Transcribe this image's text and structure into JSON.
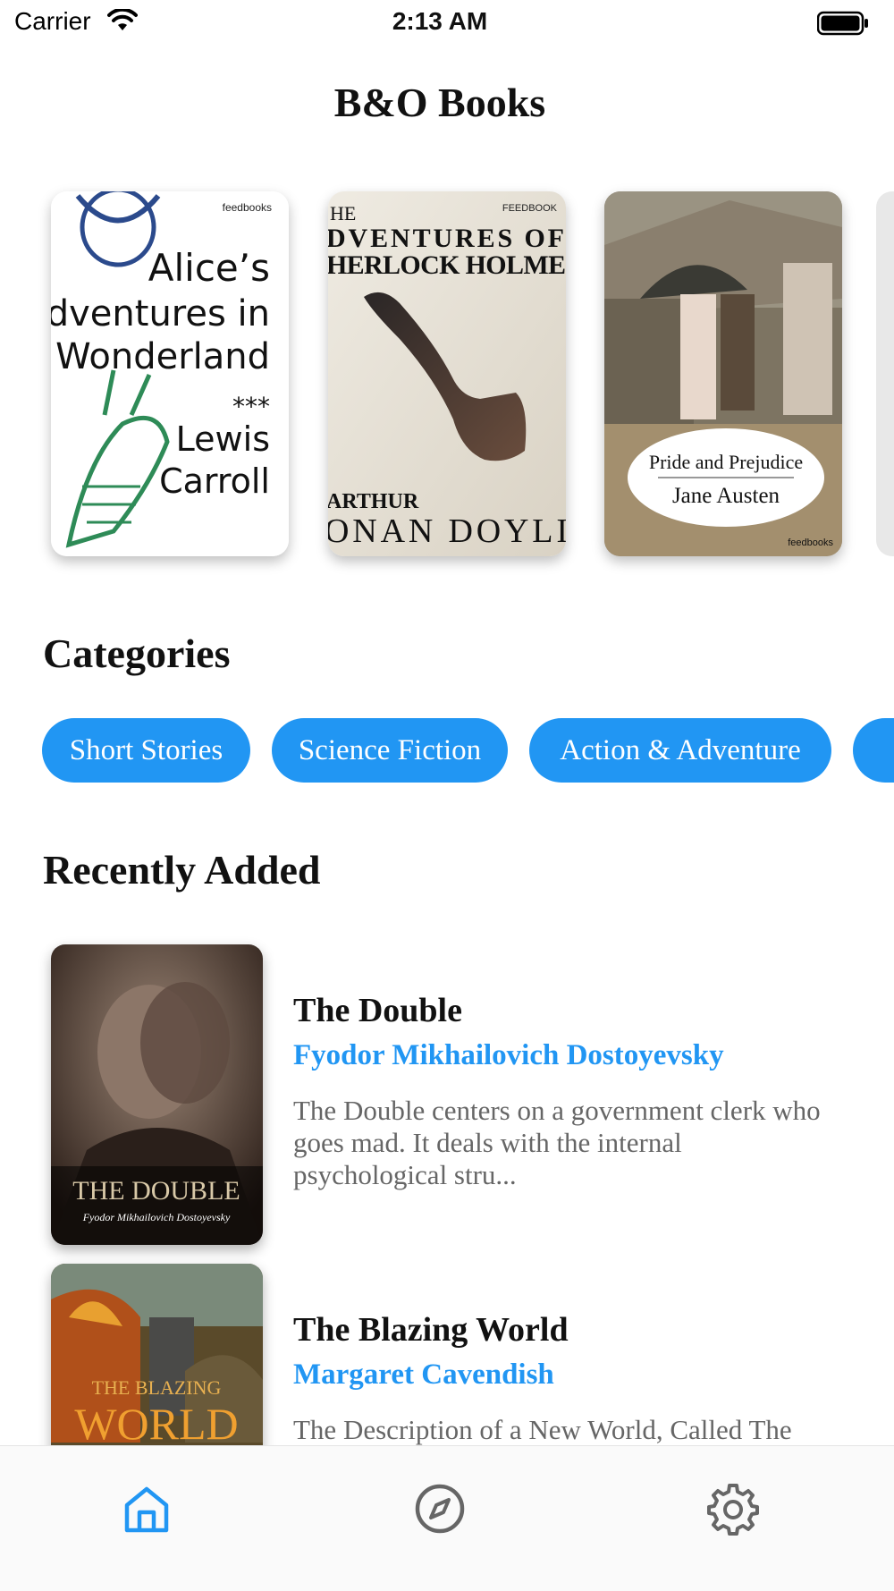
{
  "status_bar": {
    "carrier": "Carrier",
    "time": "2:13 AM"
  },
  "app_title": "B&O Books",
  "featured": [
    {
      "title_lines": [
        "Alice’s",
        "Adventures in",
        "Wonderland"
      ],
      "stars": "***",
      "author_lines": [
        "Lewis",
        "Carroll"
      ],
      "publisher": "feedbooks"
    },
    {
      "title_lines": [
        "HE",
        "DVENTURES OF",
        "HERLOCK HOLME"
      ],
      "author_lines": [
        "ARTHUR",
        "ONAN DOYLI"
      ],
      "publisher": "FEEDBOOK"
    },
    {
      "title": "Pride and Prejudice",
      "author": "Jane Austen",
      "publisher": "feedbooks"
    }
  ],
  "categories": {
    "title": "Categories",
    "items": [
      "Short Stories",
      "Science Fiction",
      "Action & Adventure"
    ]
  },
  "recent": {
    "title": "Recently Added",
    "books": [
      {
        "title": "The Double",
        "author": "Fyodor Mikhailovich Dostoyevsky",
        "description": "The Double centers on a government clerk who goes mad. It deals with the internal psychological stru...",
        "cover_title": "THE DOUBLE",
        "cover_author": "Fyodor Mikhailovich Dostoyevsky"
      },
      {
        "title": "The Blazing World",
        "author": "Margaret Cavendish",
        "description": "The Description of a New World, Called The",
        "cover_title_lines": [
          "THE BLAZING",
          "WORLD"
        ]
      }
    ]
  },
  "tabs": [
    {
      "name": "home",
      "icon": "home-icon",
      "active": true
    },
    {
      "name": "explore",
      "icon": "compass-icon",
      "active": false
    },
    {
      "name": "settings",
      "icon": "gear-icon",
      "active": false
    }
  ],
  "colors": {
    "accent": "#2196f3",
    "inactive": "#666666"
  }
}
